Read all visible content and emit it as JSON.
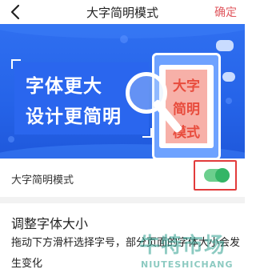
{
  "header": {
    "title": "大字简明模式",
    "confirm_label": "确定",
    "back_icon": "chevron-left-icon"
  },
  "banner": {
    "headline_line1": "字体更大",
    "headline_line2": "设计更简明",
    "card_words": [
      "大字",
      "简明",
      "模式"
    ]
  },
  "settings": {
    "toggle_label": "大字简明模式",
    "toggle_on": true,
    "toggle_color": "#34b566"
  },
  "font_section": {
    "title": "调整字体大小",
    "description": "拖动下方滑杆选择字号，部分页面的字体大小会发生变化"
  },
  "watermark": {
    "text_cn": "牛特市场",
    "text_en": "NIUTESHICHANG"
  },
  "colors": {
    "accent": "#e0585f",
    "banner_blue": "#2563e8",
    "highlight_red": "#e23b3b"
  }
}
